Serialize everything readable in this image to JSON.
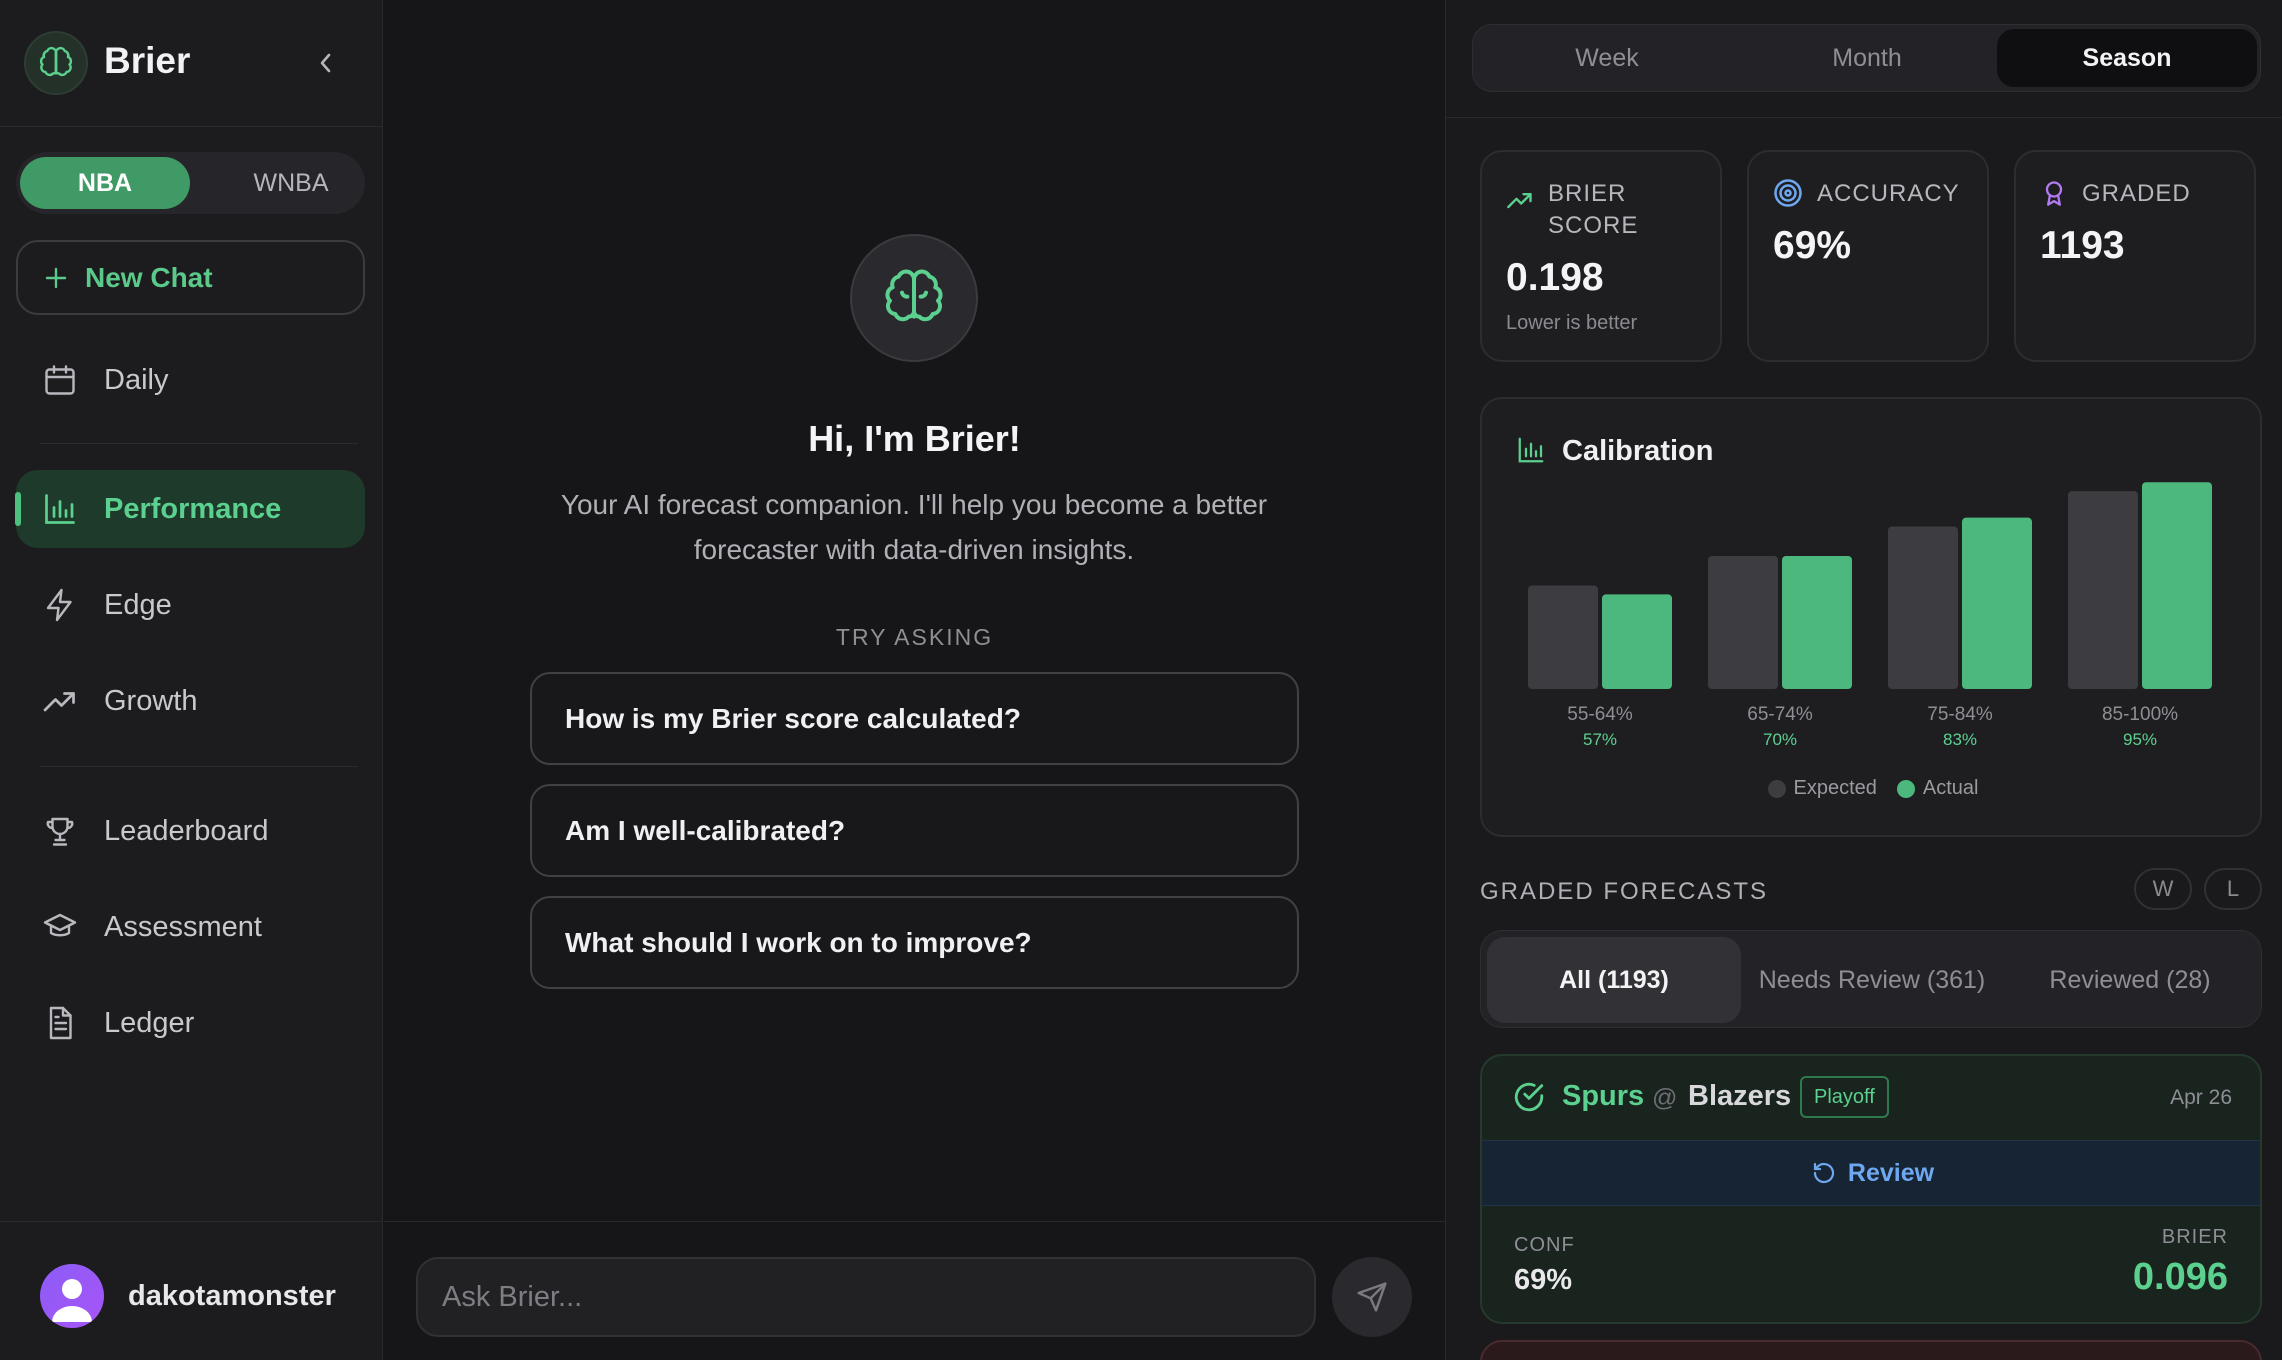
{
  "app": {
    "title": "Brier"
  },
  "sidebar": {
    "leagues": [
      "NBA",
      "WNBA"
    ],
    "new_chat": "New Chat",
    "items": [
      {
        "label": "Daily",
        "icon": "calendar-icon"
      },
      {
        "label": "Performance",
        "icon": "bar-chart-icon",
        "active": true
      },
      {
        "label": "Edge",
        "icon": "lightning-icon"
      },
      {
        "label": "Growth",
        "icon": "trending-up-icon"
      },
      {
        "label": "Leaderboard",
        "icon": "trophy-icon"
      },
      {
        "label": "Assessment",
        "icon": "graduation-cap-icon"
      },
      {
        "label": "Ledger",
        "icon": "document-icon"
      }
    ],
    "user": {
      "name": "dakotamonster"
    }
  },
  "chat": {
    "greeting": "Hi, I'm Brier!",
    "subtitle": "Your AI forecast companion. I'll help you become a better forecaster with data-driven insights.",
    "try_label": "TRY ASKING",
    "suggestions": [
      "How is my Brier score calculated?",
      "Am I well-calibrated?",
      "What should I work on to improve?"
    ],
    "input_placeholder": "Ask Brier..."
  },
  "panel": {
    "periods": [
      "Week",
      "Month",
      "Season"
    ],
    "active_period": "Season",
    "stats": {
      "brier": {
        "label": "BRIER SCORE",
        "value": "0.198",
        "note": "Lower is better"
      },
      "accuracy": {
        "label": "ACCURACY",
        "value": "69%"
      },
      "graded": {
        "label": "GRADED",
        "value": "1193"
      }
    },
    "calibration_title": "Calibration",
    "graded_label": "GRADED FORECASTS",
    "wl": [
      "W",
      "L"
    ],
    "filters": [
      "All (1193)",
      "Needs Review (361)",
      "Reviewed (28)"
    ],
    "forecast": {
      "team1": "Spurs",
      "at": "@",
      "team2": "Blazers",
      "badge": "Playoff",
      "date": "Apr 26",
      "review": "Review",
      "conf_label": "CONF",
      "conf_value": "69%",
      "brier_label": "BRIER",
      "brier_value": "0.096"
    }
  },
  "colors": {
    "accent": "#3f9a66",
    "accent_text": "#5bd08f",
    "expected_bar": "#3c3c41",
    "actual_bar": "#4cb87e",
    "review_blue": "#6ea8f0"
  },
  "chart_data": {
    "type": "bar",
    "categories": [
      "55-64%",
      "65-74%",
      "75-84%",
      "85-100%"
    ],
    "actual_labels": [
      "57%",
      "70%",
      "83%",
      "95%"
    ],
    "series": [
      {
        "name": "Expected",
        "values": [
          60,
          70,
          80,
          92
        ]
      },
      {
        "name": "Actual",
        "values": [
          57,
          70,
          83,
          95
        ]
      }
    ],
    "ylim": [
      0,
      100
    ],
    "legend": "bottom-center"
  }
}
